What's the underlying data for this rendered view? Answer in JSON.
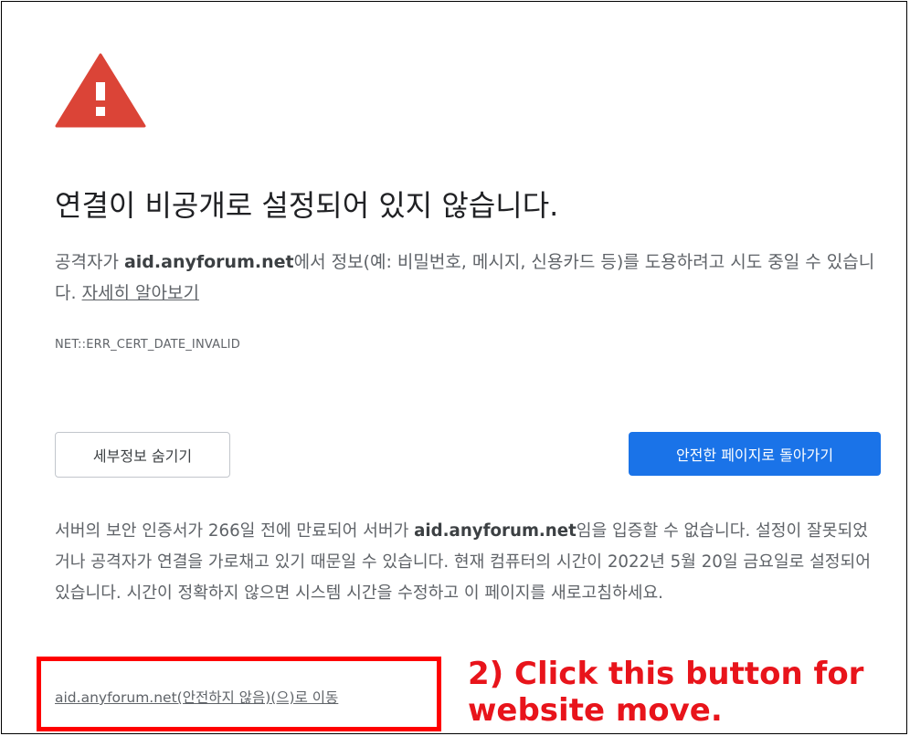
{
  "page": {
    "icon": "warning-triangle-icon",
    "title": "연결이 비공개로 설정되어 있지 않습니다.",
    "description": {
      "before_host": "공격자가 ",
      "host": "aid.anyforum.net",
      "after_host": "에서 정보(예: 비밀번호, 메시지, 신용카드 등)를 도용하려고 시도 중일 수 있습니다. ",
      "learn_more": "자세히 알아보기"
    },
    "error_code": "NET::ERR_CERT_DATE_INVALID",
    "buttons": {
      "hide_details": "세부정보 숨기기",
      "back_to_safety": "안전한 페이지로 돌아가기"
    },
    "details": {
      "before_host": "서버의 보안 인증서가 266일 전에 만료되어 서버가 ",
      "host": "aid.anyforum.net",
      "after_host": "임을 입증할 수 없습니다. 설정이 잘못되었거나 공격자가 연결을 가로채고 있기 때문일 수 있습니다. 현재 컴퓨터의 시간이 2022년 5월 20일 금요일로 설정되어 있습니다. 시간이 정확하지 않으면 시스템 시간을 수정하고 이 페이지를 새로고침하세요."
    },
    "proceed_link": "aid.anyforum.net(안전하지 않음)(으)로 이동"
  },
  "annotation": {
    "line1": "2) Click this button for",
    "line2": "website move."
  },
  "colors": {
    "warning_red": "#db4437",
    "primary_blue": "#1a73e8",
    "annotation_red": "#e8141b",
    "highlight_box": "#ff0000"
  }
}
